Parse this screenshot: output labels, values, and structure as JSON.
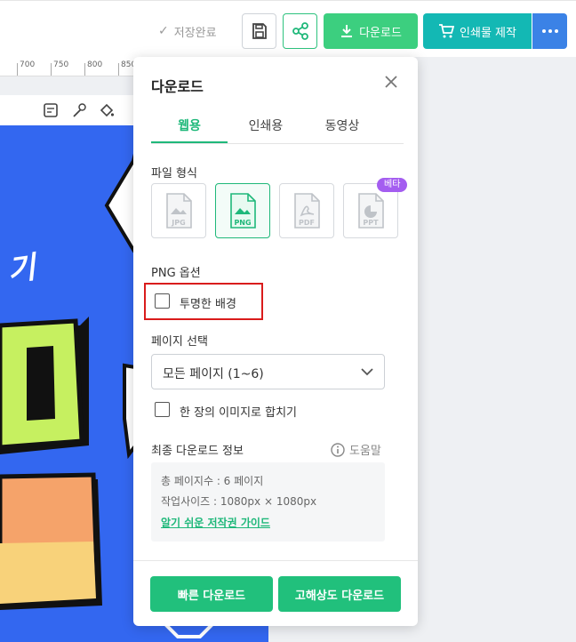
{
  "toolbar": {
    "saved_status": "저장완료",
    "download_label": "다운로드",
    "print_label": "인쇄물 제작",
    "colors": {
      "download": "#3ccf7f",
      "print": "#13b8b4",
      "more": "#3b82e6"
    }
  },
  "ruler": {
    "ticks": [
      "700",
      "750",
      "800",
      "850"
    ]
  },
  "canvas": {
    "text": "기"
  },
  "panel": {
    "title": "다운로드",
    "tabs": [
      {
        "label": "웹용",
        "active": true
      },
      {
        "label": "인쇄용",
        "active": false
      },
      {
        "label": "동영상",
        "active": false
      }
    ],
    "file_format_label": "파일 형식",
    "formats": [
      {
        "label": "JPG",
        "selected": false
      },
      {
        "label": "PNG",
        "selected": true
      },
      {
        "label": "PDF",
        "selected": false
      },
      {
        "label": "PPT",
        "selected": false
      }
    ],
    "beta_badge": "베타",
    "png_options_label": "PNG 옵션",
    "transparent_bg_label": "투명한 배경",
    "page_select_label": "페이지 선택",
    "page_select_value": "모든 페이지 (1~6)",
    "merge_label": "한 장의 이미지로 합치기",
    "final_info_label": "최종 다운로드 정보",
    "help_label": "도움말",
    "info": {
      "total_pages": "총 페이지수 : 6 페이지",
      "work_size": "작업사이즈 : 1080px × 1080px",
      "guide_link": "알기 쉬운 저작권 가이드"
    },
    "quick_download": "빠른 다운로드",
    "hq_download": "고해상도 다운로드",
    "accent_color": "#1fb87a"
  }
}
